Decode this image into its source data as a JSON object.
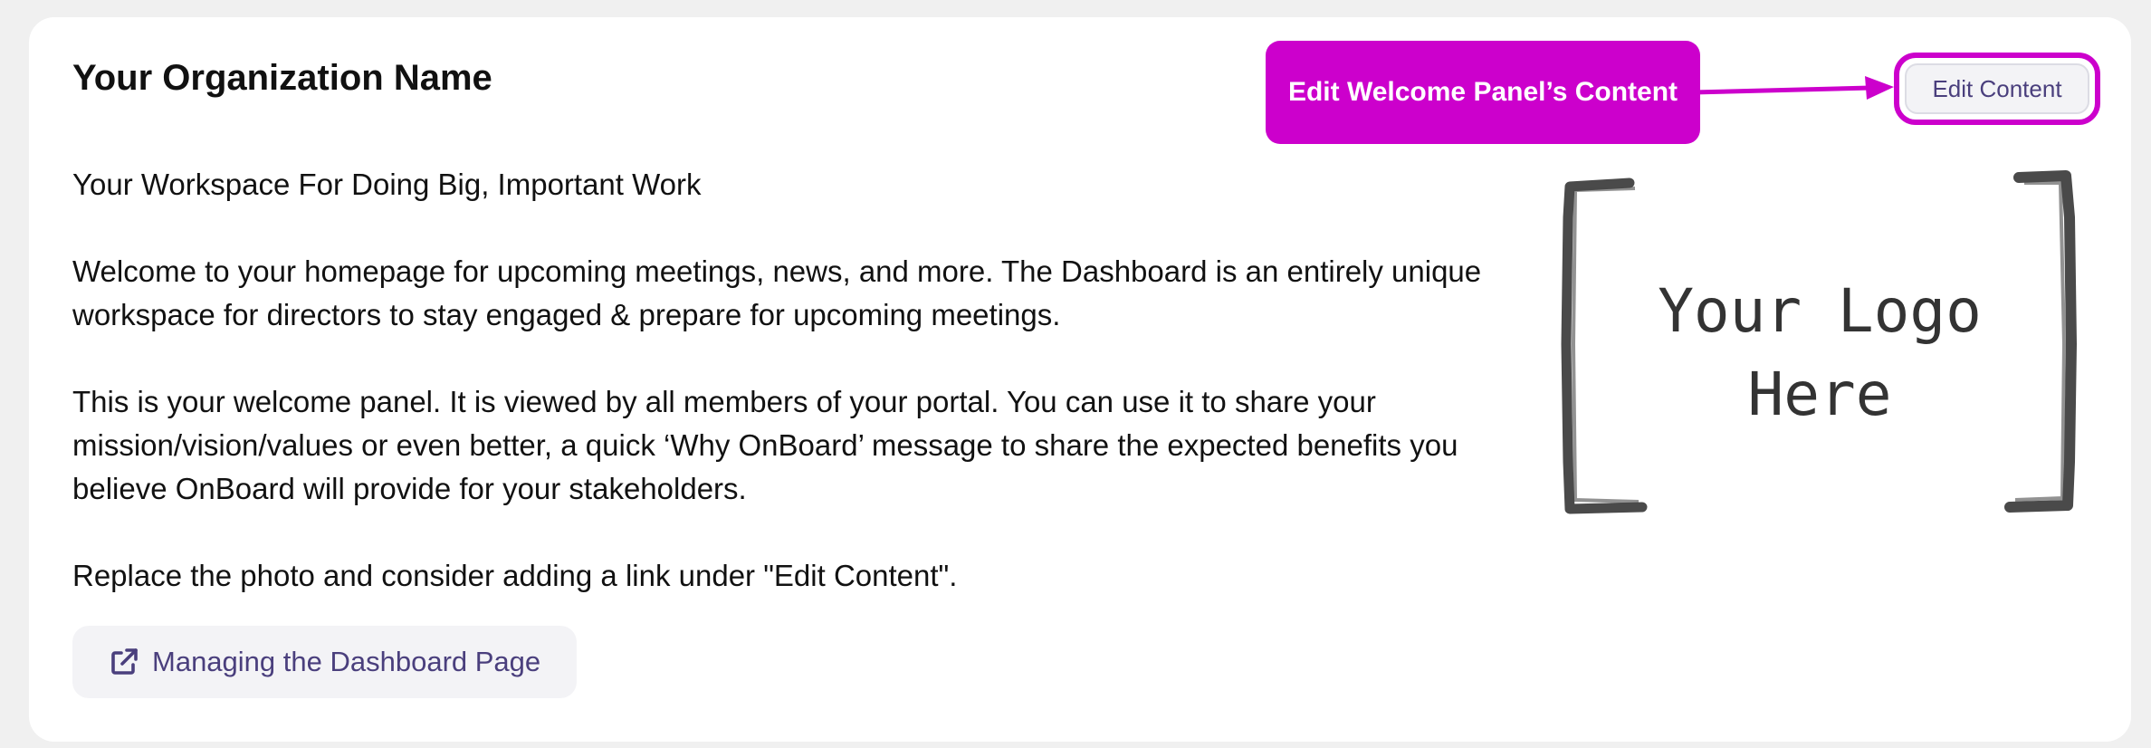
{
  "panel": {
    "title": "Your Organization Name",
    "tagline": "Your Workspace For Doing Big, Important Work",
    "paragraphs": [
      "Welcome to your homepage for upcoming meetings, news, and more. The Dashboard is an entirely unique workspace for directors to stay engaged & prepare for upcoming meetings.",
      "This is your welcome panel. It is viewed by all members of your portal. You can use it to share your mission/vision/values or even better, a quick ‘Why OnBoard’ message to share the expected benefits you believe OnBoard will provide for your stakeholders.",
      "Replace the photo and consider adding a link under \"Edit Content\"."
    ],
    "link": {
      "label": "Managing the Dashboard Page",
      "icon": "external-link-icon"
    },
    "edit_button_label": "Edit Content"
  },
  "annotation": {
    "callout_text": "Edit Welcome Panel’s Content",
    "color": "#cc00cc"
  },
  "logo": {
    "line1": "Your Logo",
    "line2": "Here"
  },
  "colors": {
    "accent_text": "#4a3f7d",
    "button_bg": "#f3f3f6",
    "page_bg": "#f0f0f0"
  }
}
